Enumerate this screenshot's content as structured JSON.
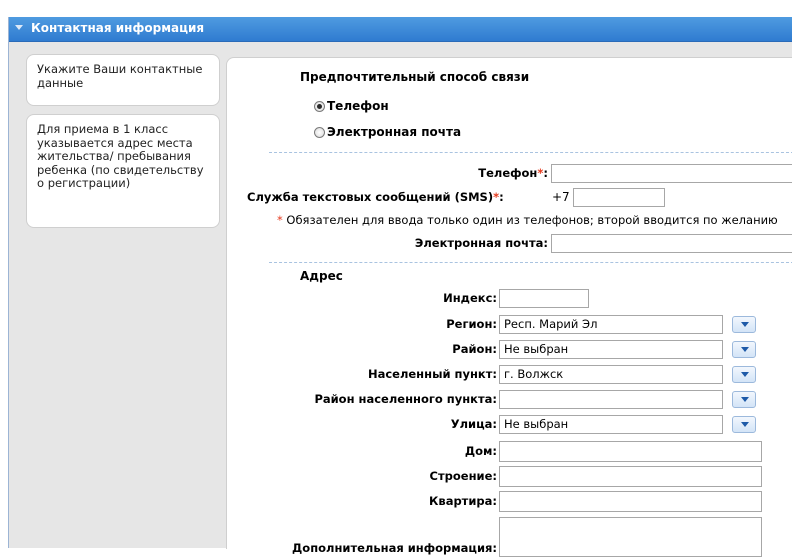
{
  "panel": {
    "title": "Контактная информация"
  },
  "hints": [
    "Укажите Ваши контактные данные",
    "Для приема в 1 класс указывается адрес места жительства/ пребывания ребенка (по свидетельству о регистрации)"
  ],
  "contact": {
    "section_title": "Предпочтительный способ связи",
    "option_phone": "Телефон",
    "option_email": "Электронная почта",
    "selected": "Телефон"
  },
  "phone": {
    "label": "Телефон",
    "required_mark": "*",
    "colon": ":",
    "value": ""
  },
  "sms": {
    "label": "Служба текстовых сообщений (SMS)",
    "required_mark": "*",
    "colon": ":",
    "prefix": "+7",
    "value": ""
  },
  "note": {
    "mark": "*",
    "text": "Обязателен для ввода только один из телефонов; второй вводится по желанию"
  },
  "email": {
    "label": "Электронная почта:",
    "value": ""
  },
  "address": {
    "title": "Адрес",
    "index": {
      "label": "Индекс:",
      "value": ""
    },
    "region": {
      "label": "Регион:",
      "value": "Респ. Марий Эл"
    },
    "district": {
      "label": "Район:",
      "value": "Не выбран"
    },
    "locality": {
      "label": "Населенный пункт:",
      "value": "г. Волжск"
    },
    "locality_district": {
      "label": "Район населенного пункта:",
      "value": ""
    },
    "street": {
      "label": "Улица:",
      "value": "Не выбран"
    },
    "house": {
      "label": "Дом:",
      "value": ""
    },
    "building": {
      "label": "Строение:",
      "value": ""
    },
    "apartment": {
      "label": "Квартира:",
      "value": ""
    },
    "extra": {
      "label": "Дополнительная информация:",
      "value": ""
    }
  },
  "colors": {
    "header": "#2f7bd0",
    "required": "#e53a1e",
    "panel_bg": "#e6e6e6"
  },
  "icons": {
    "collapse": "triangle-down-icon",
    "dropdown": "chevron-down-icon"
  }
}
